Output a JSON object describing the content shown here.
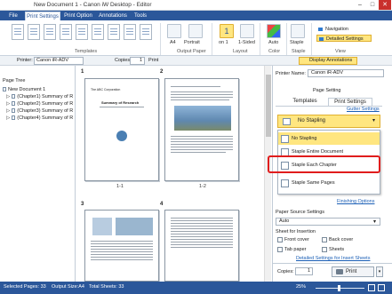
{
  "titlebar": {
    "title": "New Document 1 - Canon iW Desktop - Editor",
    "min": "–",
    "max": "□",
    "close": "✕"
  },
  "tabs": [
    {
      "label": "File"
    },
    {
      "label": "Print Settings"
    },
    {
      "label": "Print Option"
    },
    {
      "label": "Annotations"
    },
    {
      "label": "Tools"
    }
  ],
  "ribbon": {
    "groups": {
      "templates": "Templates",
      "output_paper": "Output Paper",
      "layout": "Layout",
      "color": "Color",
      "staple": "Staple",
      "view": "View"
    },
    "paper_size": "A4",
    "orientation": "Portrait",
    "pages_per_sheet_value": "1",
    "pages_per_sheet": "on 1",
    "sided": "1-Sided",
    "color_mode": "Auto",
    "staple_label": "Staple",
    "navigation": "Navigation",
    "detailed_settings": "Detailed Settings"
  },
  "toolbar": {
    "printer_label": "Printer:",
    "printer_value": "Canon iR-ADV",
    "copies_label": "Copies:",
    "copies_value": "1",
    "print": "Print",
    "display_annotations": "Display Annotations"
  },
  "left": {
    "title": "Page Tree",
    "items": [
      {
        "label": "New Document 1"
      },
      {
        "label": "(Chapter1) Summary of R"
      },
      {
        "label": "(Chapter2) Summary of R"
      },
      {
        "label": "(Chapter3) Summary of R"
      },
      {
        "label": "(Chapter4) Summary of R"
      }
    ]
  },
  "doc": {
    "pages": [
      {
        "num": "1",
        "label": "1-1"
      },
      {
        "num": "2",
        "label": "1-2"
      },
      {
        "num": "3",
        "label": ""
      },
      {
        "num": "4",
        "label": ""
      }
    ],
    "page1_heading": "The ABC Corporation",
    "page1_title": "Summary of Research"
  },
  "right": {
    "printer_label": "Printer Name:",
    "printer_value": "Canon iR-ADV",
    "page_setting": "Page Setting",
    "tab_templates": "Templates",
    "tab_print_settings": "Print Settings",
    "gutter_settings": "Gutter Settings",
    "staple_selected": "No Stapling",
    "staple_options": [
      {
        "label": "No Stapling"
      },
      {
        "label": "Staple Entire Document"
      },
      {
        "label": "Staple Each Chapter"
      },
      {
        "label": "Staple Same Pages"
      }
    ],
    "finishing_options": "Finishing Options",
    "paper_source": "Paper Source Settings",
    "paper_source_value": "Auto",
    "sheet_insertion": "Sheet for Insertion",
    "front_cover": "Front cover",
    "back_cover": "Back cover",
    "tab_paper": "Tab paper",
    "sheets": "Sheets",
    "detailed_insert": "Detailed Settings for Insert Sheets",
    "copies_label": "Copies:",
    "copies_value": "1",
    "print": "Print"
  },
  "status": {
    "selected_pages": "Selected Pages: 33",
    "output_size": "Output Size:A4",
    "total_sheets": "Total Sheets: 33",
    "zoom": "25%"
  },
  "colors": {
    "accent": "#2b579a",
    "highlight": "#ffe680",
    "callout": "#e01d1d"
  }
}
